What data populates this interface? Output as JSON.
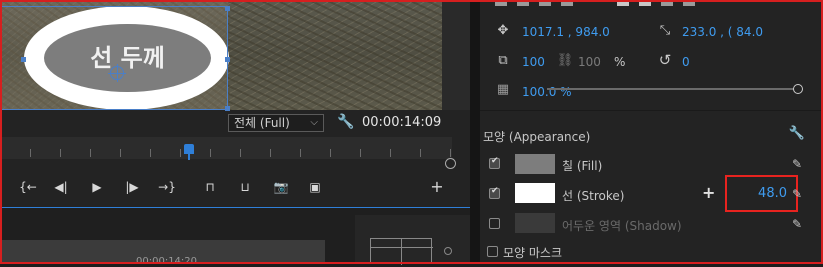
{
  "colors": {
    "accent_blue": "#3f9cf0",
    "highlight_red": "#e8231f",
    "fill_swatch": "#7d7d7d",
    "stroke_swatch": "#ffffff",
    "shadow_swatch": "#3a3a3a"
  },
  "preview": {
    "text_overlay": "선 두께",
    "fit_select_value": "전체 (Full)",
    "timecode": "00:00:14:09"
  },
  "timeline": {
    "sequence_timecode": "00:00:14:20",
    "controls": [
      {
        "name": "mark-in-icon",
        "glyph": "{←"
      },
      {
        "name": "step-back-icon",
        "glyph": "◀|"
      },
      {
        "name": "play-icon",
        "glyph": "▶"
      },
      {
        "name": "step-forward-icon",
        "glyph": "|▶"
      },
      {
        "name": "mark-out-icon",
        "glyph": "→}"
      },
      {
        "name": "lift-icon",
        "glyph": "⊓"
      },
      {
        "name": "extract-icon",
        "glyph": "⊔"
      },
      {
        "name": "camera-icon",
        "glyph": "📷"
      },
      {
        "name": "compare-icon",
        "glyph": "▣"
      },
      {
        "name": "add-icon",
        "glyph": "+"
      }
    ]
  },
  "transform": {
    "position": "1017.1 , 984.0",
    "anchor": "233.0 , ( 84.0",
    "scale": "100",
    "scale_width": "100",
    "scale_unit": "%",
    "rotation": "0",
    "opacity": "100.0 %",
    "opacity_level_percent": 100
  },
  "appearance": {
    "header": "모양 (Appearance)",
    "fill_label": "칠 (Fill)",
    "fill_checked": true,
    "stroke_label": "선 (Stroke)",
    "stroke_checked": true,
    "stroke_width": "48.0",
    "shadow_label": "어두운 영역 (Shadow)",
    "shadow_checked": false,
    "mask_label": "모양 마스크",
    "mask_checked": false
  }
}
